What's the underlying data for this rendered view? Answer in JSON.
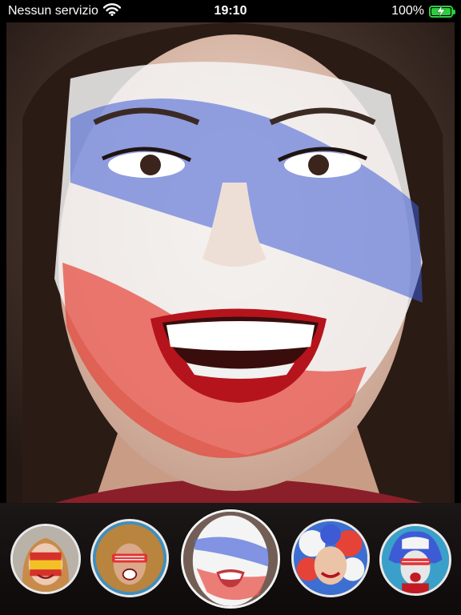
{
  "status_bar": {
    "carrier": "Nessun servizio",
    "time": "19:10",
    "battery_percent": "100%",
    "battery_level": 1.0
  },
  "main": {
    "photo_icon": "face-paint-preview-image"
  },
  "filters": {
    "selected_index": 2,
    "items": [
      {
        "icon": "spain-flag-face-icon"
      },
      {
        "icon": "shutter-glasses-curly-hair-icon"
      },
      {
        "icon": "france-face-paint-icon"
      },
      {
        "icon": "france-confetti-wig-icon"
      },
      {
        "icon": "france-glasses-wig-icon"
      }
    ]
  },
  "colors": {
    "flag_blue": "#3e5bd6",
    "flag_white": "#f4f4f4",
    "flag_red": "#e64338",
    "battery_green": "#2ecc40"
  }
}
